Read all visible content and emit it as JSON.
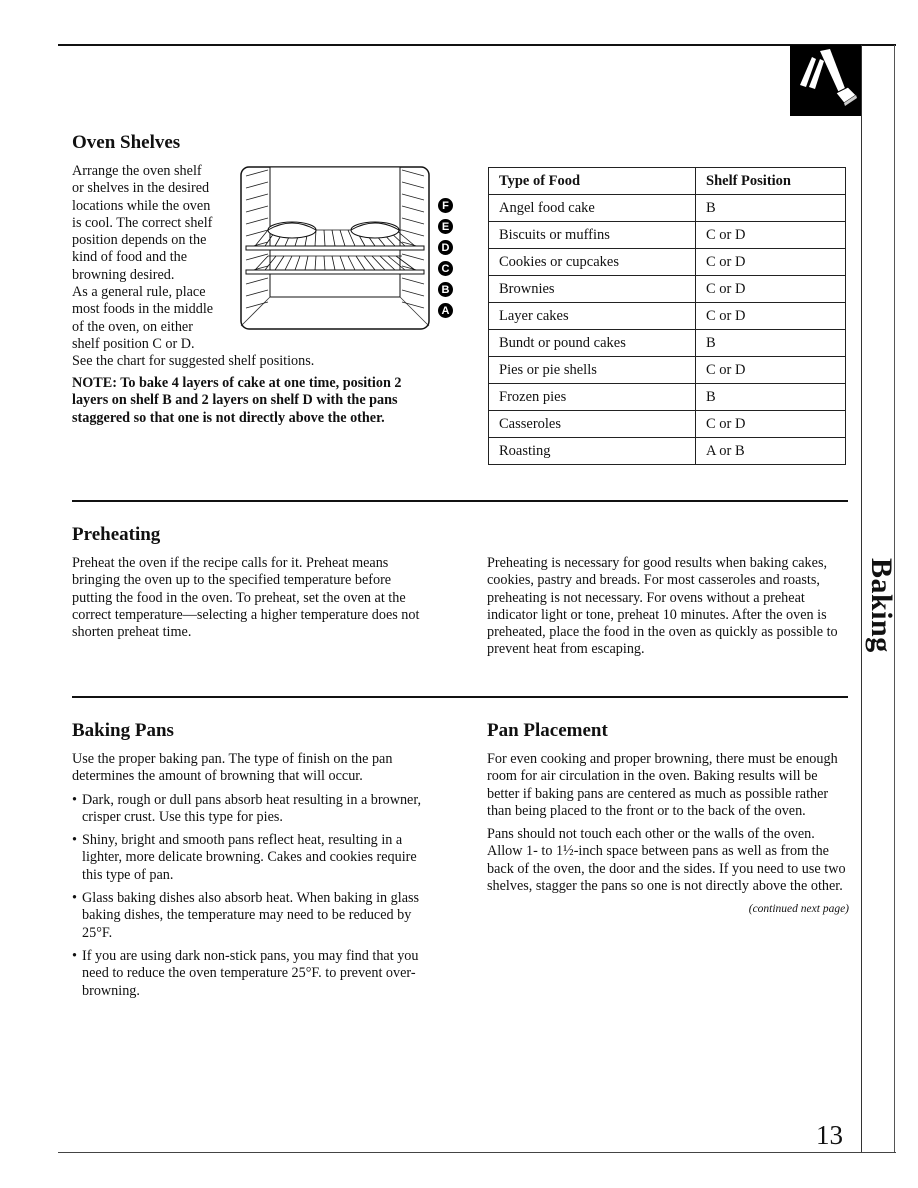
{
  "side_tab": {
    "label": "Baking",
    "icon": "hand-pressing-button-icon"
  },
  "oven_shelves": {
    "heading": "Oven Shelves",
    "intro_lines": [
      "Arrange the oven shelf",
      "or shelves in the desired",
      "locations while the oven",
      "is cool. The correct shelf",
      "position depends on the",
      "kind of food and the",
      "browning desired.",
      "As a general rule, place",
      "most foods in the middle",
      "of the oven, on either",
      "shelf position C or D.",
      "See the chart for suggested shelf positions."
    ],
    "note": "NOTE: To bake 4 layers of cake at one time, position 2 layers on shelf B and 2 layers on shelf D with the pans staggered so that one is not directly above the other.",
    "diagram": {
      "shelf_labels": [
        "F",
        "E",
        "D",
        "C",
        "B",
        "A"
      ]
    },
    "table": {
      "headers": [
        "Type of Food",
        "Shelf Position"
      ],
      "rows": [
        [
          "Angel food cake",
          "B"
        ],
        [
          "Biscuits or muffins",
          "C or D"
        ],
        [
          "Cookies or cupcakes",
          "C or D"
        ],
        [
          "Brownies",
          "C or D"
        ],
        [
          "Layer cakes",
          "C or D"
        ],
        [
          "Bundt or pound cakes",
          "B"
        ],
        [
          "Pies or pie shells",
          "C or D"
        ],
        [
          "Frozen pies",
          "B"
        ],
        [
          "Casseroles",
          "C or D"
        ],
        [
          "Roasting",
          "A or B"
        ]
      ]
    }
  },
  "preheating": {
    "heading": "Preheating",
    "left_text": "Preheat the oven if the recipe calls for it. Preheat means bringing the oven up to the specified temperature before putting the food in the oven. To preheat, set the oven at the correct temperature—selecting a higher temperature does not shorten preheat time.",
    "right_text": "Preheating is necessary for good results when baking cakes, cookies, pastry and breads. For most casseroles and roasts, preheating is not necessary. For ovens without a preheat indicator light or tone, preheat 10 minutes. After the oven is preheated, place the food in the oven as quickly as possible to prevent heat from escaping."
  },
  "baking_pans": {
    "heading": "Baking Pans",
    "intro": "Use the proper baking pan. The type of finish on the pan determines the amount of browning that will occur.",
    "bullets": [
      "Dark, rough or dull pans absorb heat resulting in a browner, crisper crust. Use this type for pies.",
      "Shiny, bright and smooth pans reflect heat, resulting in a lighter, more delicate browning. Cakes and cookies require this type of pan.",
      "Glass baking dishes also absorb heat. When baking in glass baking dishes, the temperature may need to be reduced by 25°F.",
      "If you are using dark non-stick pans, you may find that you need to reduce the oven temperature 25°F. to prevent over-browning."
    ]
  },
  "pan_placement": {
    "heading": "Pan Placement",
    "paragraphs": [
      "For even cooking and proper browning, there must be enough room for air circulation in the oven. Baking results will be better if baking pans are centered as much as possible rather than being placed to the front or to the back of the oven.",
      "Pans should not touch each other or the walls of the oven. Allow 1- to 1½-inch space between pans as well as from the back of the oven, the door and the sides. If you need to use two shelves, stagger the pans so one is not directly above the other."
    ],
    "continued": "(continued next page)"
  },
  "page_number": "13"
}
